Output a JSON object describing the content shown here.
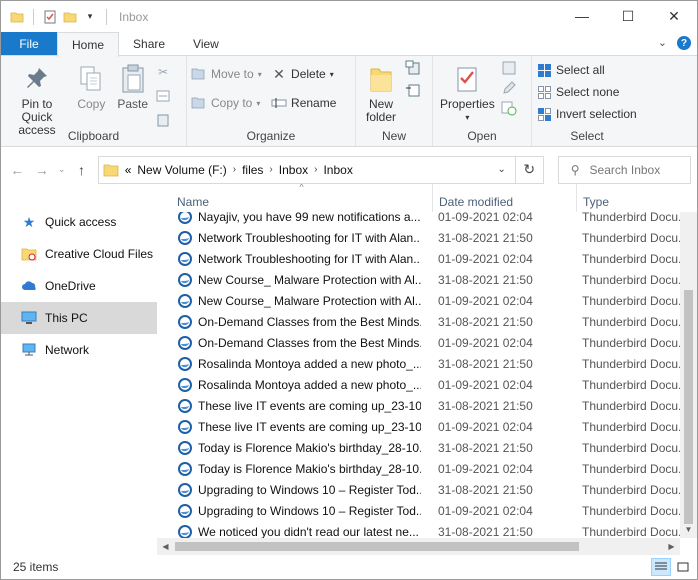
{
  "window": {
    "title": "Inbox"
  },
  "ribbon_tabs": {
    "file": "File",
    "home": "Home",
    "share": "Share",
    "view": "View"
  },
  "clipboard": {
    "pin": "Pin to Quick access",
    "copy": "Copy",
    "paste": "Paste",
    "label": "Clipboard"
  },
  "organize": {
    "move_to": "Move to",
    "copy_to": "Copy to",
    "delete": "Delete",
    "rename": "Rename",
    "label": "Organize"
  },
  "new_group": {
    "new_folder": "New folder",
    "label": "New"
  },
  "open_group": {
    "properties": "Properties",
    "label": "Open"
  },
  "select_group": {
    "select_all": "Select all",
    "select_none": "Select none",
    "invert": "Invert selection",
    "label": "Select"
  },
  "address": {
    "overflow": "«",
    "crumbs": [
      "New Volume (F:)",
      "files",
      "Inbox",
      "Inbox"
    ],
    "search_placeholder": "Search Inbox"
  },
  "nav_pane": {
    "items": [
      "Quick access",
      "Creative Cloud Files",
      "OneDrive",
      "This PC",
      "Network"
    ],
    "selected": "This PC"
  },
  "columns": {
    "name": "Name",
    "date": "Date modified",
    "type": "Type"
  },
  "files": [
    {
      "name": "Nayajiv, you have 99 new notifications a...",
      "date": "01-09-2021 02:04",
      "type": "Thunderbird Docu..."
    },
    {
      "name": "Network Troubleshooting for IT with Alan...",
      "date": "31-08-2021 21:50",
      "type": "Thunderbird Docu..."
    },
    {
      "name": "Network Troubleshooting for IT with Alan...",
      "date": "01-09-2021 02:04",
      "type": "Thunderbird Docu..."
    },
    {
      "name": "New Course_ Malware Protection with Al...",
      "date": "31-08-2021 21:50",
      "type": "Thunderbird Docu..."
    },
    {
      "name": "New Course_ Malware Protection with Al...",
      "date": "01-09-2021 02:04",
      "type": "Thunderbird Docu..."
    },
    {
      "name": "On-Demand Classes from the Best Minds...",
      "date": "31-08-2021 21:50",
      "type": "Thunderbird Docu..."
    },
    {
      "name": "On-Demand Classes from the Best Minds...",
      "date": "01-09-2021 02:04",
      "type": "Thunderbird Docu..."
    },
    {
      "name": "Rosalinda Montoya added a new photo_...",
      "date": "31-08-2021 21:50",
      "type": "Thunderbird Docu..."
    },
    {
      "name": "Rosalinda Montoya added a new photo_...",
      "date": "01-09-2021 02:04",
      "type": "Thunderbird Docu..."
    },
    {
      "name": "These live IT events are coming up_23-10...",
      "date": "31-08-2021 21:50",
      "type": "Thunderbird Docu..."
    },
    {
      "name": "These live IT events are coming up_23-10...",
      "date": "01-09-2021 02:04",
      "type": "Thunderbird Docu..."
    },
    {
      "name": "Today is Florence Makio's birthday_28-10...",
      "date": "31-08-2021 21:50",
      "type": "Thunderbird Docu..."
    },
    {
      "name": "Today is Florence Makio's birthday_28-10...",
      "date": "01-09-2021 02:04",
      "type": "Thunderbird Docu..."
    },
    {
      "name": "Upgrading to Windows 10 – Register Tod...",
      "date": "31-08-2021 21:50",
      "type": "Thunderbird Docu..."
    },
    {
      "name": "Upgrading to Windows 10 – Register Tod...",
      "date": "01-09-2021 02:04",
      "type": "Thunderbird Docu..."
    },
    {
      "name": "We noticed you didn't read our latest ne...",
      "date": "31-08-2021 21:50",
      "type": "Thunderbird Docu..."
    }
  ],
  "status": {
    "count": "25 items"
  },
  "colors": {
    "accent": "#1979ca",
    "selected_nav": "#d9d9d9",
    "header_text": "#4c607a"
  }
}
